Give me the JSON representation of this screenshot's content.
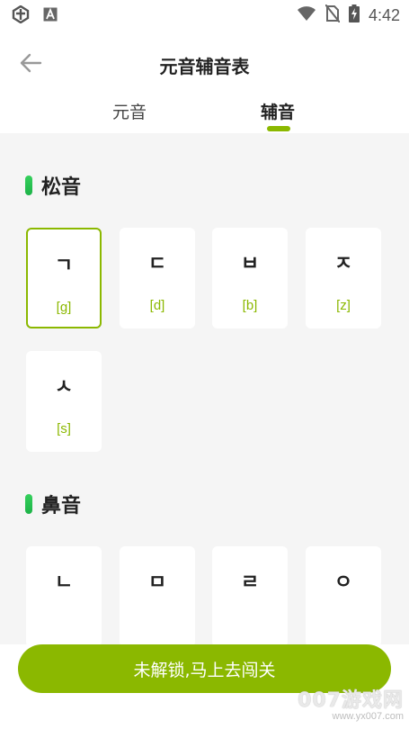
{
  "statusbar": {
    "time": "4:42",
    "left_icons": [
      "bug-app-icon",
      "notification-a-icon"
    ],
    "right_icons": [
      "wifi-icon",
      "no-sim-icon",
      "battery-charging-icon"
    ]
  },
  "header": {
    "title": "元音辅音表",
    "back_icon": "arrow-left-icon"
  },
  "tabs": [
    {
      "label": "元音",
      "active": false
    },
    {
      "label": "辅音",
      "active": true
    }
  ],
  "sections": [
    {
      "title": "松音",
      "cards": [
        {
          "glyph": "ㄱ",
          "roman": "[g]",
          "selected": true
        },
        {
          "glyph": "ㄷ",
          "roman": "[d]",
          "selected": false
        },
        {
          "glyph": "ㅂ",
          "roman": "[b]",
          "selected": false
        },
        {
          "glyph": "ㅈ",
          "roman": "[z]",
          "selected": false
        },
        {
          "glyph": "ㅅ",
          "roman": "[s]",
          "selected": false
        }
      ]
    },
    {
      "title": "鼻音",
      "cards": [
        {
          "glyph": "ㄴ"
        },
        {
          "glyph": "ㅁ"
        },
        {
          "glyph": "ㄹ"
        },
        {
          "glyph": "ㅇ"
        }
      ]
    }
  ],
  "bottom": {
    "button_label": "未解锁,马上去闯关"
  },
  "watermark": {
    "main": "007游戏网",
    "url": "www.yx007.com"
  },
  "colors": {
    "accent": "#8bb800",
    "section_bar": "#2ac450",
    "content_bg": "#f5f5f5"
  }
}
